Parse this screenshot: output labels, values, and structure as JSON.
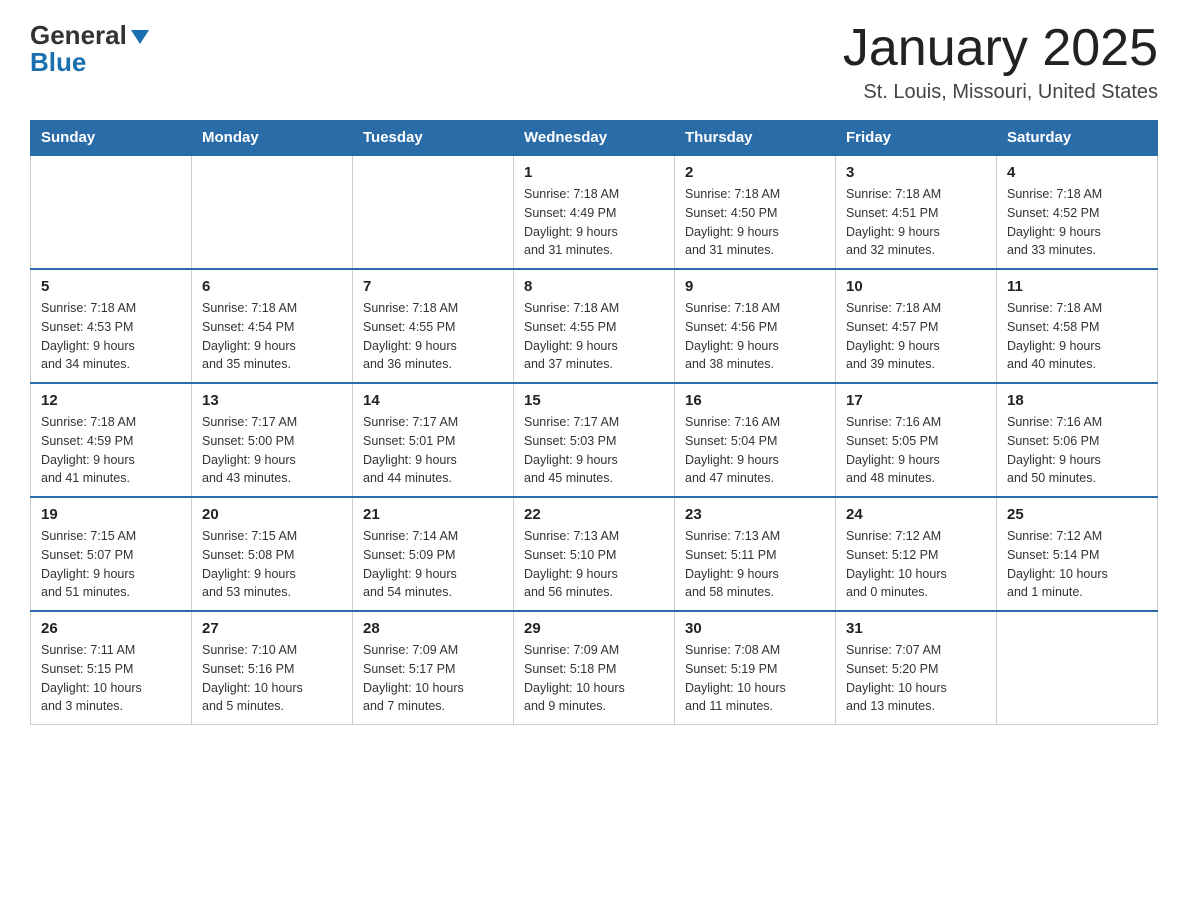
{
  "header": {
    "logo_line1": "General",
    "logo_line2": "Blue",
    "month_title": "January 2025",
    "location": "St. Louis, Missouri, United States"
  },
  "weekdays": [
    "Sunday",
    "Monday",
    "Tuesday",
    "Wednesday",
    "Thursday",
    "Friday",
    "Saturday"
  ],
  "weeks": [
    [
      {
        "day": "",
        "info": ""
      },
      {
        "day": "",
        "info": ""
      },
      {
        "day": "",
        "info": ""
      },
      {
        "day": "1",
        "info": "Sunrise: 7:18 AM\nSunset: 4:49 PM\nDaylight: 9 hours\nand 31 minutes."
      },
      {
        "day": "2",
        "info": "Sunrise: 7:18 AM\nSunset: 4:50 PM\nDaylight: 9 hours\nand 31 minutes."
      },
      {
        "day": "3",
        "info": "Sunrise: 7:18 AM\nSunset: 4:51 PM\nDaylight: 9 hours\nand 32 minutes."
      },
      {
        "day": "4",
        "info": "Sunrise: 7:18 AM\nSunset: 4:52 PM\nDaylight: 9 hours\nand 33 minutes."
      }
    ],
    [
      {
        "day": "5",
        "info": "Sunrise: 7:18 AM\nSunset: 4:53 PM\nDaylight: 9 hours\nand 34 minutes."
      },
      {
        "day": "6",
        "info": "Sunrise: 7:18 AM\nSunset: 4:54 PM\nDaylight: 9 hours\nand 35 minutes."
      },
      {
        "day": "7",
        "info": "Sunrise: 7:18 AM\nSunset: 4:55 PM\nDaylight: 9 hours\nand 36 minutes."
      },
      {
        "day": "8",
        "info": "Sunrise: 7:18 AM\nSunset: 4:55 PM\nDaylight: 9 hours\nand 37 minutes."
      },
      {
        "day": "9",
        "info": "Sunrise: 7:18 AM\nSunset: 4:56 PM\nDaylight: 9 hours\nand 38 minutes."
      },
      {
        "day": "10",
        "info": "Sunrise: 7:18 AM\nSunset: 4:57 PM\nDaylight: 9 hours\nand 39 minutes."
      },
      {
        "day": "11",
        "info": "Sunrise: 7:18 AM\nSunset: 4:58 PM\nDaylight: 9 hours\nand 40 minutes."
      }
    ],
    [
      {
        "day": "12",
        "info": "Sunrise: 7:18 AM\nSunset: 4:59 PM\nDaylight: 9 hours\nand 41 minutes."
      },
      {
        "day": "13",
        "info": "Sunrise: 7:17 AM\nSunset: 5:00 PM\nDaylight: 9 hours\nand 43 minutes."
      },
      {
        "day": "14",
        "info": "Sunrise: 7:17 AM\nSunset: 5:01 PM\nDaylight: 9 hours\nand 44 minutes."
      },
      {
        "day": "15",
        "info": "Sunrise: 7:17 AM\nSunset: 5:03 PM\nDaylight: 9 hours\nand 45 minutes."
      },
      {
        "day": "16",
        "info": "Sunrise: 7:16 AM\nSunset: 5:04 PM\nDaylight: 9 hours\nand 47 minutes."
      },
      {
        "day": "17",
        "info": "Sunrise: 7:16 AM\nSunset: 5:05 PM\nDaylight: 9 hours\nand 48 minutes."
      },
      {
        "day": "18",
        "info": "Sunrise: 7:16 AM\nSunset: 5:06 PM\nDaylight: 9 hours\nand 50 minutes."
      }
    ],
    [
      {
        "day": "19",
        "info": "Sunrise: 7:15 AM\nSunset: 5:07 PM\nDaylight: 9 hours\nand 51 minutes."
      },
      {
        "day": "20",
        "info": "Sunrise: 7:15 AM\nSunset: 5:08 PM\nDaylight: 9 hours\nand 53 minutes."
      },
      {
        "day": "21",
        "info": "Sunrise: 7:14 AM\nSunset: 5:09 PM\nDaylight: 9 hours\nand 54 minutes."
      },
      {
        "day": "22",
        "info": "Sunrise: 7:13 AM\nSunset: 5:10 PM\nDaylight: 9 hours\nand 56 minutes."
      },
      {
        "day": "23",
        "info": "Sunrise: 7:13 AM\nSunset: 5:11 PM\nDaylight: 9 hours\nand 58 minutes."
      },
      {
        "day": "24",
        "info": "Sunrise: 7:12 AM\nSunset: 5:12 PM\nDaylight: 10 hours\nand 0 minutes."
      },
      {
        "day": "25",
        "info": "Sunrise: 7:12 AM\nSunset: 5:14 PM\nDaylight: 10 hours\nand 1 minute."
      }
    ],
    [
      {
        "day": "26",
        "info": "Sunrise: 7:11 AM\nSunset: 5:15 PM\nDaylight: 10 hours\nand 3 minutes."
      },
      {
        "day": "27",
        "info": "Sunrise: 7:10 AM\nSunset: 5:16 PM\nDaylight: 10 hours\nand 5 minutes."
      },
      {
        "day": "28",
        "info": "Sunrise: 7:09 AM\nSunset: 5:17 PM\nDaylight: 10 hours\nand 7 minutes."
      },
      {
        "day": "29",
        "info": "Sunrise: 7:09 AM\nSunset: 5:18 PM\nDaylight: 10 hours\nand 9 minutes."
      },
      {
        "day": "30",
        "info": "Sunrise: 7:08 AM\nSunset: 5:19 PM\nDaylight: 10 hours\nand 11 minutes."
      },
      {
        "day": "31",
        "info": "Sunrise: 7:07 AM\nSunset: 5:20 PM\nDaylight: 10 hours\nand 13 minutes."
      },
      {
        "day": "",
        "info": ""
      }
    ]
  ]
}
